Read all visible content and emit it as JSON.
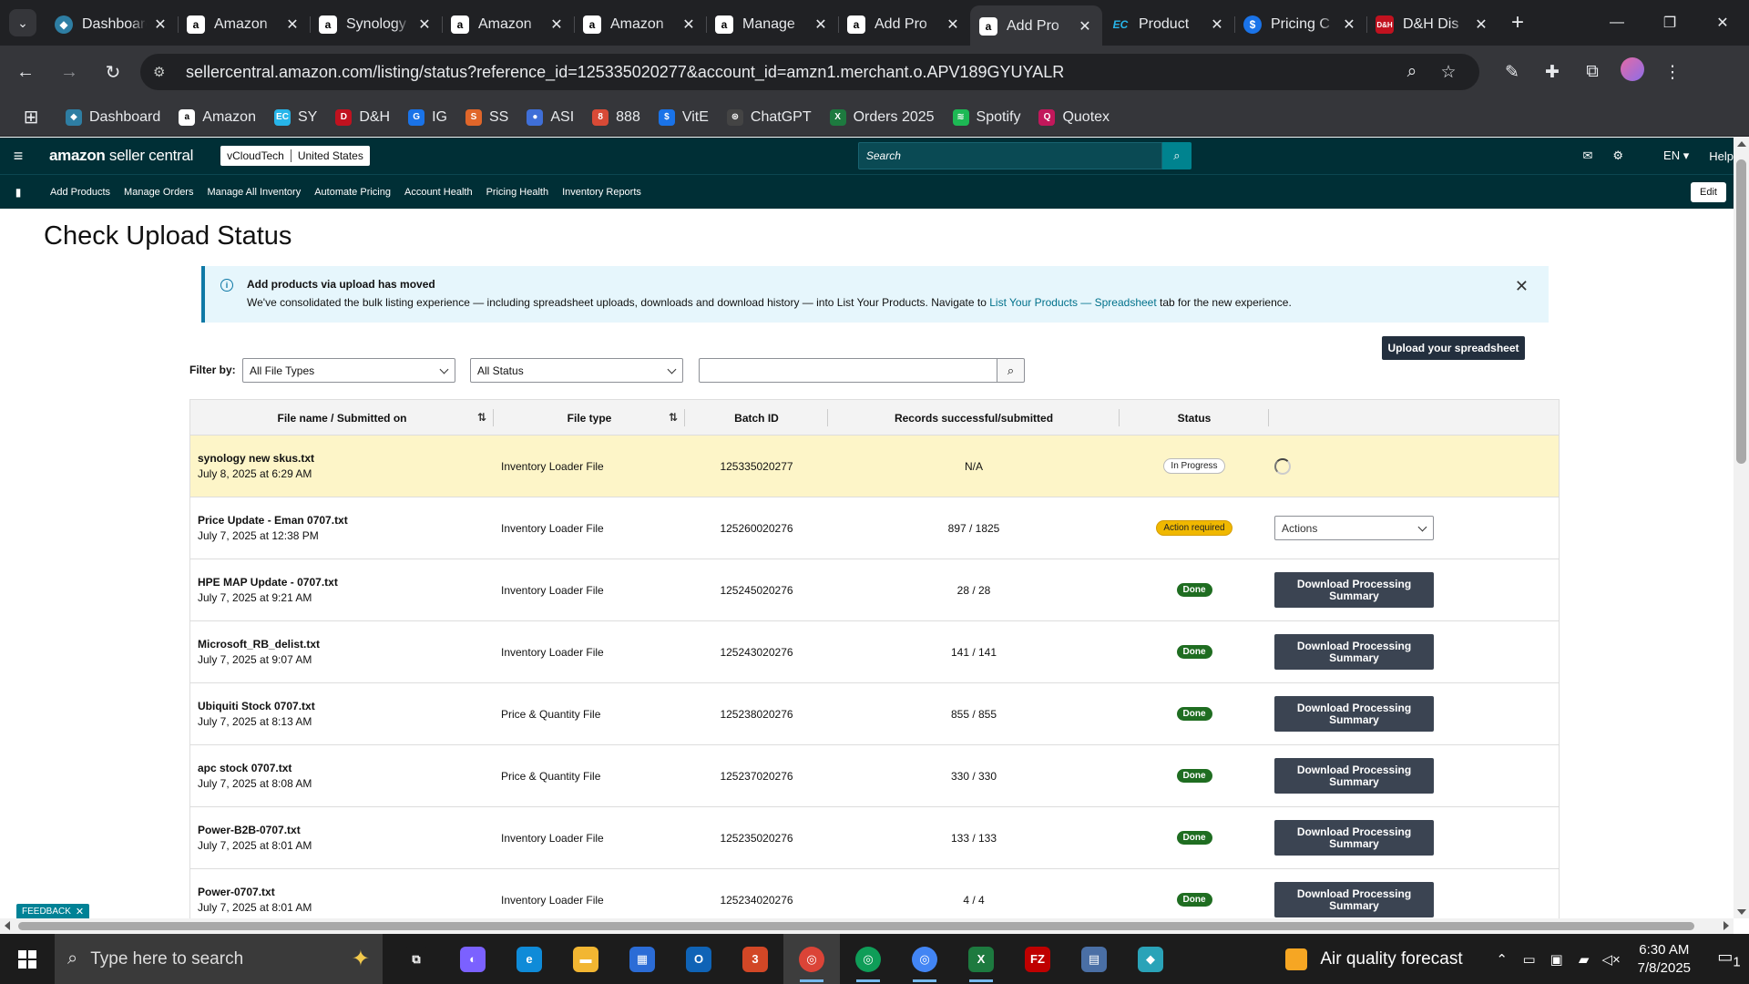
{
  "browser": {
    "tabs": [
      {
        "title": "Dashboard",
        "icon": "dashboard-favicon",
        "active": false
      },
      {
        "title": "Amazon",
        "icon": "amazon-favicon",
        "active": false
      },
      {
        "title": "Synology",
        "icon": "amazon-favicon",
        "active": false
      },
      {
        "title": "Amazon",
        "icon": "amazon-favicon",
        "active": false
      },
      {
        "title": "Amazon",
        "icon": "amazon-favicon",
        "active": false
      },
      {
        "title": "Manage",
        "icon": "amazon-favicon",
        "active": false
      },
      {
        "title": "Add Pro",
        "icon": "amazon-favicon",
        "active": false
      },
      {
        "title": "Add Pro",
        "icon": "amazon-favicon",
        "active": true
      },
      {
        "title": "Product",
        "icon": "ec-favicon",
        "active": false
      },
      {
        "title": "Pricing C",
        "icon": "pricing-favicon",
        "active": false
      },
      {
        "title": "D&H Dis",
        "icon": "dh-favicon",
        "active": false
      }
    ],
    "url": "sellercentral.amazon.com/listing/status?reference_id=125335020277&account_id=amzn1.merchant.o.APV189GYUYALR",
    "bookmarks": [
      {
        "label": "Dashboard",
        "color": "#2e7ea3",
        "glyph": "◆"
      },
      {
        "label": "Amazon",
        "color": "#ffffff",
        "glyph": "a"
      },
      {
        "label": "SY",
        "color": "#27b5e9",
        "glyph": "EC"
      },
      {
        "label": "D&H",
        "color": "#c1121f",
        "glyph": "D"
      },
      {
        "label": "IG",
        "color": "#1a73e8",
        "glyph": "G"
      },
      {
        "label": "SS",
        "color": "#e0662a",
        "glyph": "S"
      },
      {
        "label": "ASI",
        "color": "#3f6fd8",
        "glyph": "●"
      },
      {
        "label": "888",
        "color": "#d84a36",
        "glyph": "8"
      },
      {
        "label": "VitE",
        "color": "#1a73e8",
        "glyph": "$"
      },
      {
        "label": "ChatGPT",
        "color": "#444444",
        "glyph": "⊛"
      },
      {
        "label": "Orders 2025",
        "color": "#1d7a3f",
        "glyph": "X"
      },
      {
        "label": "Spotify",
        "color": "#1db954",
        "glyph": "≋"
      },
      {
        "label": "Quotex",
        "color": "#c2185b",
        "glyph": "Q"
      }
    ]
  },
  "seller_central": {
    "logo_bold": "amazon",
    "logo_light": " seller central",
    "account_name": "vCloudTech",
    "marketplace": "United States",
    "search_placeholder": "Search",
    "language": "EN",
    "help": "Help",
    "nav_links": [
      "Add Products",
      "Manage Orders",
      "Manage All Inventory",
      "Automate Pricing",
      "Account Health",
      "Pricing Health",
      "Inventory Reports"
    ],
    "edit_label": "Edit"
  },
  "page": {
    "title": "Check Upload Status",
    "notice": {
      "title": "Add products via upload has moved",
      "body_before": "We've consolidated the bulk listing experience — including spreadsheet uploads, downloads and download history — into List Your Products. Navigate to ",
      "link": "List Your Products — Spreadsheet",
      "body_after": " tab for the new experience."
    },
    "upload_button": "Upload your spreadsheet",
    "filter_label": "Filter by:",
    "file_type_selected": "All File Types",
    "status_selected": "All Status",
    "search_value": ""
  },
  "table": {
    "headers": {
      "file": "File name / Submitted on",
      "type": "File type",
      "batch": "Batch ID",
      "records": "Records successful/submitted",
      "status": "Status"
    },
    "rows": [
      {
        "name": "synology new skus.txt",
        "date": "July 8, 2025 at 6:29 AM",
        "type": "Inventory Loader File",
        "batch": "125335020277",
        "records": "N/A",
        "status": "In Progress",
        "status_kind": "progress",
        "action": "spinner"
      },
      {
        "name": "Price Update - Eman 0707.txt",
        "date": "July 7, 2025 at 12:38 PM",
        "type": "Inventory Loader File",
        "batch": "125260020276",
        "records": "897 / 1825",
        "status": "Action required",
        "status_kind": "action",
        "action": "select",
        "action_label": "Actions"
      },
      {
        "name": "HPE MAP Update - 0707.txt",
        "date": "July 7, 2025 at 9:21 AM",
        "type": "Inventory Loader File",
        "batch": "125245020276",
        "records": "28 / 28",
        "status": "Done",
        "status_kind": "done",
        "action": "button",
        "action_label": "Download Processing Summary"
      },
      {
        "name": "Microsoft_RB_delist.txt",
        "date": "July 7, 2025 at 9:07 AM",
        "type": "Inventory Loader File",
        "batch": "125243020276",
        "records": "141 / 141",
        "status": "Done",
        "status_kind": "done",
        "action": "button",
        "action_label": "Download Processing Summary"
      },
      {
        "name": "Ubiquiti Stock 0707.txt",
        "date": "July 7, 2025 at 8:13 AM",
        "type": "Price & Quantity File",
        "batch": "125238020276",
        "records": "855 / 855",
        "status": "Done",
        "status_kind": "done",
        "action": "button",
        "action_label": "Download Processing Summary"
      },
      {
        "name": "apc stock 0707.txt",
        "date": "July 7, 2025 at 8:08 AM",
        "type": "Price & Quantity File",
        "batch": "125237020276",
        "records": "330 / 330",
        "status": "Done",
        "status_kind": "done",
        "action": "button",
        "action_label": "Download Processing Summary"
      },
      {
        "name": "Power-B2B-0707.txt",
        "date": "July 7, 2025 at 8:01 AM",
        "type": "Inventory Loader File",
        "batch": "125235020276",
        "records": "133 / 133",
        "status": "Done",
        "status_kind": "done",
        "action": "button",
        "action_label": "Download Processing Summary"
      },
      {
        "name": "Power-0707.txt",
        "date": "July 7, 2025 at 8:01 AM",
        "type": "Inventory Loader File",
        "batch": "125234020276",
        "records": "4 / 4",
        "status": "Done",
        "status_kind": "done",
        "action": "button",
        "action_label": "Download Processing Summary"
      }
    ]
  },
  "feedback_label": "FEEDBACK",
  "taskbar": {
    "search_placeholder": "Type here to search",
    "weather": "Air quality forecast",
    "time": "6:30 AM",
    "date": "7/8/2025",
    "notification_count": "1",
    "apps": [
      {
        "name": "task-view",
        "color": "#1c1c1c",
        "glyph": "⧉",
        "active": false,
        "open": false
      },
      {
        "name": "copilot",
        "color": "#7b61ff",
        "glyph": "◐",
        "active": false,
        "open": false
      },
      {
        "name": "edge",
        "color": "#0f8bd8",
        "glyph": "e",
        "active": false,
        "open": false
      },
      {
        "name": "file-explorer",
        "color": "#f2b632",
        "glyph": "▬",
        "active": false,
        "open": false
      },
      {
        "name": "microsoft-store",
        "color": "#2b6cd6",
        "glyph": "▦",
        "active": false,
        "open": false
      },
      {
        "name": "outlook",
        "color": "#0f63b6",
        "glyph": "O",
        "active": false,
        "open": false
      },
      {
        "name": "teams",
        "color": "#d24726",
        "glyph": "3",
        "active": false,
        "open": false
      },
      {
        "name": "chrome-profile-1",
        "color": "#db4437",
        "glyph": "◎",
        "active": true,
        "open": true
      },
      {
        "name": "chrome-profile-2",
        "color": "#0f9d58",
        "glyph": "◎",
        "active": false,
        "open": true
      },
      {
        "name": "chrome-profile-3",
        "color": "#4285f4",
        "glyph": "◎",
        "active": false,
        "open": true
      },
      {
        "name": "excel",
        "color": "#1d7a3f",
        "glyph": "X",
        "active": false,
        "open": true
      },
      {
        "name": "filezilla",
        "color": "#bf0000",
        "glyph": "FZ",
        "active": false,
        "open": false
      },
      {
        "name": "calculator",
        "color": "#4a6fa5",
        "glyph": "▤",
        "active": false,
        "open": false
      },
      {
        "name": "app-diamond",
        "color": "#2aa3b8",
        "glyph": "◆",
        "active": false,
        "open": false
      }
    ]
  }
}
